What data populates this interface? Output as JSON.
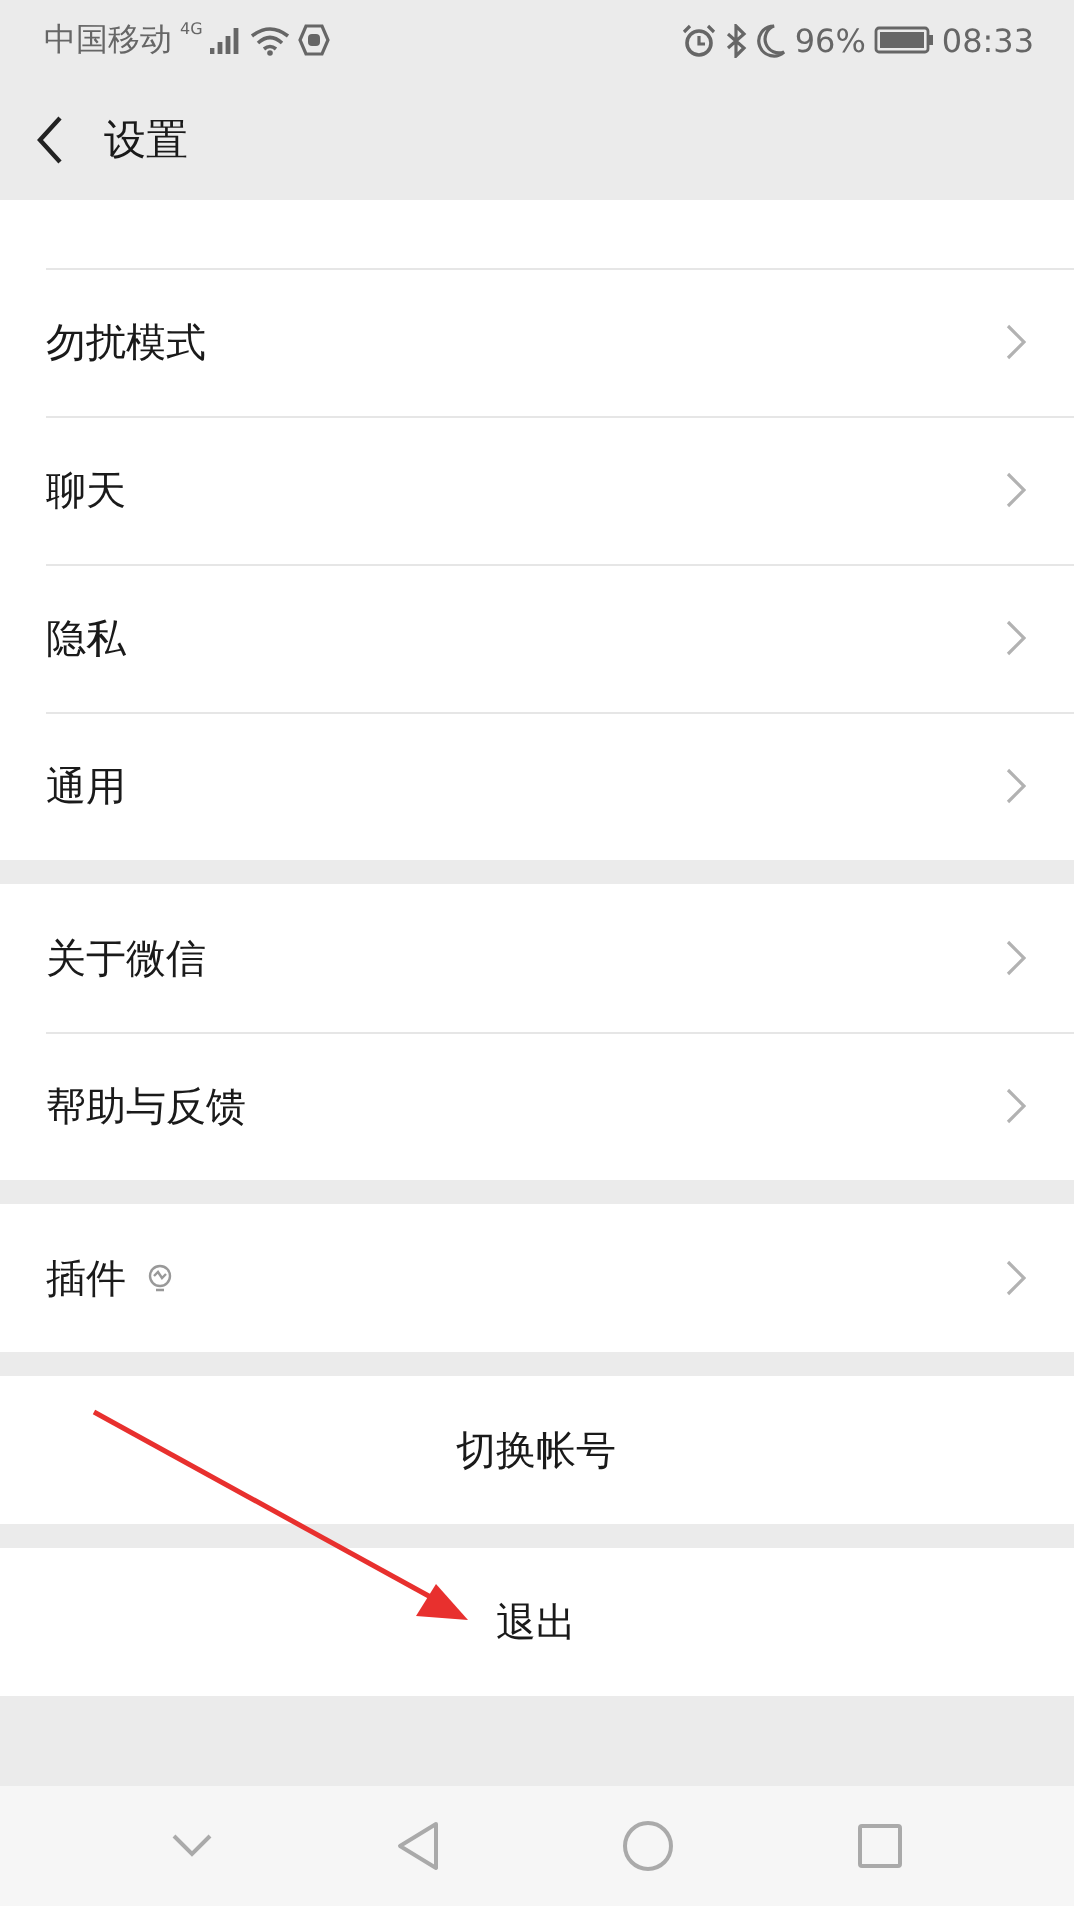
{
  "status_bar": {
    "carrier": "中国移动",
    "network": "4G",
    "battery": "96%",
    "time": "08:33"
  },
  "header": {
    "title": "设置"
  },
  "groups": [
    {
      "items": [
        {
          "label": "勿扰模式",
          "kind": "link"
        },
        {
          "label": "聊天",
          "kind": "link"
        },
        {
          "label": "隐私",
          "kind": "link"
        },
        {
          "label": "通用",
          "kind": "link"
        }
      ]
    },
    {
      "items": [
        {
          "label": "关于微信",
          "kind": "link"
        },
        {
          "label": "帮助与反馈",
          "kind": "link"
        }
      ]
    },
    {
      "items": [
        {
          "label": "插件",
          "kind": "link_icon"
        }
      ]
    },
    {
      "items": [
        {
          "label": "切换帐号",
          "kind": "action"
        }
      ]
    },
    {
      "items": [
        {
          "label": "退出",
          "kind": "action"
        }
      ]
    }
  ]
}
